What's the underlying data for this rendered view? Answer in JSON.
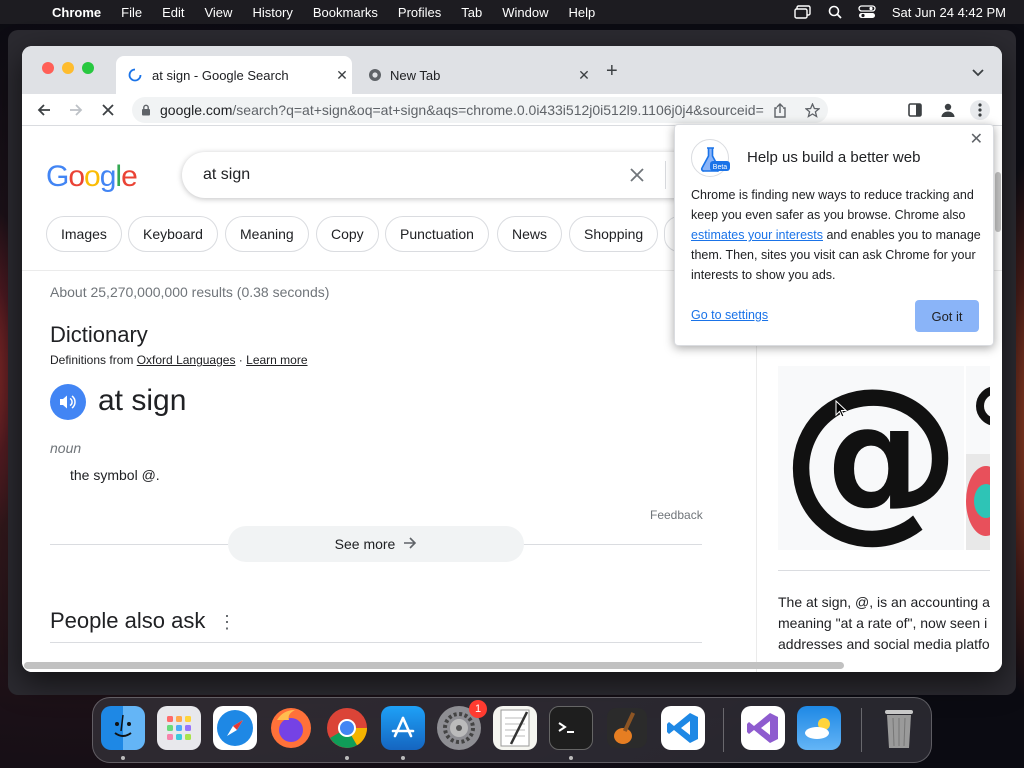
{
  "menubar": {
    "app": "Chrome",
    "items": [
      "File",
      "Edit",
      "View",
      "History",
      "Bookmarks",
      "Profiles",
      "Tab",
      "Window",
      "Help"
    ],
    "datetime": "Sat Jun 24  4:42 PM"
  },
  "tabs": [
    {
      "label": "at sign - Google Search",
      "active": true
    },
    {
      "label": "New Tab",
      "active": false
    }
  ],
  "omnibox": {
    "host": "google.com",
    "path": "/search?q=at+sign&oq=at+sign&aqs=chrome.0.0i433i512j0i512l9.1106j0j4&sourceid=..."
  },
  "search": {
    "logo": "Google",
    "query": "at sign",
    "chips": [
      "Images",
      "Keyboard",
      "Meaning",
      "Copy",
      "Punctuation",
      "News",
      "Shopping"
    ]
  },
  "results": {
    "stats": "About 25,270,000,000 results (0.38 seconds)",
    "dictionary_title": "Dictionary",
    "defs_prefix": "Definitions from",
    "defs_source": "Oxford Languages",
    "defs_sep": " · ",
    "learn_more": "Learn more",
    "word": "at sign",
    "part_of_speech": "noun",
    "meaning": "the symbol @.",
    "feedback": "Feedback",
    "see_more": "See more",
    "people_also_ask": "People also ask"
  },
  "knowledge_panel": {
    "image_symbol": "@",
    "text_lines": [
      "The at sign, @, is an accounting a",
      "meaning \"at a rate of\", now seen i",
      "addresses and social media platfo"
    ]
  },
  "popup": {
    "badge": "Beta",
    "title": "Help us build a better web",
    "body_1": "Chrome is finding new ways to reduce tracking and keep you even safer as you browse. Chrome also ",
    "body_link": "estimates your interests",
    "body_2": " and enables you to manage them. Then, sites you visit can ask Chrome for your interests to show you ads.",
    "settings_link": "Go to settings",
    "got_it": "Got it"
  },
  "dock": {
    "apps": [
      "finder",
      "launchpad",
      "safari",
      "firefox",
      "chrome",
      "app-store",
      "system-settings",
      "textedit",
      "terminal",
      "garageband",
      "vscode",
      "visual-studio",
      "weather",
      "trash"
    ],
    "system_settings_badge": "1"
  },
  "colors": {
    "google_blue": "#4285f4",
    "google_red": "#ea4335",
    "google_yellow": "#fbbc05",
    "google_green": "#34a853",
    "link": "#1a73e8",
    "button_bg": "#8ab4f8"
  }
}
